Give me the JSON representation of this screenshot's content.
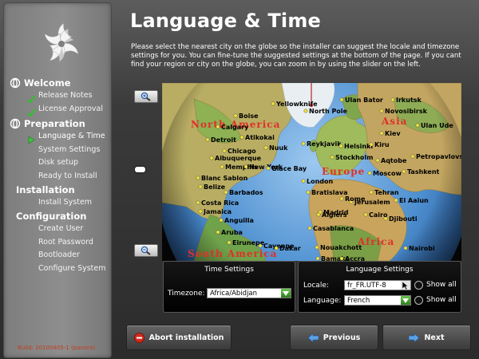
{
  "sidebar": {
    "sections": [
      {
        "label": "Welcome",
        "items": [
          {
            "label": "Release Notes",
            "state": "done"
          },
          {
            "label": "License Approval",
            "state": "done"
          }
        ]
      },
      {
        "label": "Preparation",
        "items": [
          {
            "label": "Language & Time",
            "state": "current"
          },
          {
            "label": "System Settings",
            "state": "pending"
          },
          {
            "label": "Disk setup",
            "state": "pending"
          },
          {
            "label": "Ready to Install",
            "state": "pending"
          }
        ]
      },
      {
        "label": "Installation",
        "items": [
          {
            "label": "Install System",
            "state": "pending"
          }
        ]
      },
      {
        "label": "Configuration",
        "items": [
          {
            "label": "Create User",
            "state": "pending"
          },
          {
            "label": "Root Password",
            "state": "pending"
          },
          {
            "label": "Bootloader",
            "state": "pending"
          },
          {
            "label": "Configure System",
            "state": "pending"
          }
        ]
      }
    ],
    "build": "Build: 20100405-1 (panora)"
  },
  "page": {
    "title": "Language & Time",
    "description": "Please select the nearest city on the globe so the installer can suggest the locale and timezone settings for you. You can fine-tune the suggested settings at the bottom of the page. If you cant find your region or city on the globe, you can zoom in by using the slider on the left."
  },
  "map": {
    "continents": [
      "North America",
      "Europe",
      "Asia",
      "Africa",
      "South America"
    ],
    "cities": [
      "Yellowknife",
      "North Pole",
      "Ulan Bator",
      "Irkutsk",
      "Boise",
      "Novosibirsk",
      "Calgary",
      "Kiev",
      "Ulan Ude",
      "Detroit",
      "Atikokai",
      "Reykjavik",
      "Helsinki",
      "Nuuk",
      "Chicago",
      "Kiru",
      "Stockholm",
      "Petropavlovsk",
      "Aqtobe",
      "Albuquerque",
      "Memphis",
      "New York",
      "Glace Bay",
      "London",
      "Moscow",
      "Tashkent",
      "Blanc Sablon",
      "Bratislava",
      "Tehran",
      "Belize",
      "Barbados",
      "Costa Rica",
      "Madrid",
      "Jerusalem",
      "El Aaiun",
      "Jamaica",
      "Anguilla",
      "Casablanca",
      "Djibouti",
      "Aruba",
      "Rome",
      "Algiers",
      "Cairo",
      "Eirunepe",
      "Cayenne",
      "Dakar",
      "Nouakchott",
      "Bamako",
      "Accra",
      "Nairobi"
    ]
  },
  "time_settings": {
    "title": "Time Settings",
    "timezone_label": "Timezone:",
    "timezone_value": "Africa/Abidjan"
  },
  "language_settings": {
    "title": "Language Settings",
    "locale_label": "Locale:",
    "locale_value": "fr_FR.UTF-8",
    "language_label": "Language:",
    "language_value": "French",
    "show_all": "Show all"
  },
  "buttons": {
    "abort": "Abort installation",
    "previous": "Previous",
    "next": "Next"
  }
}
